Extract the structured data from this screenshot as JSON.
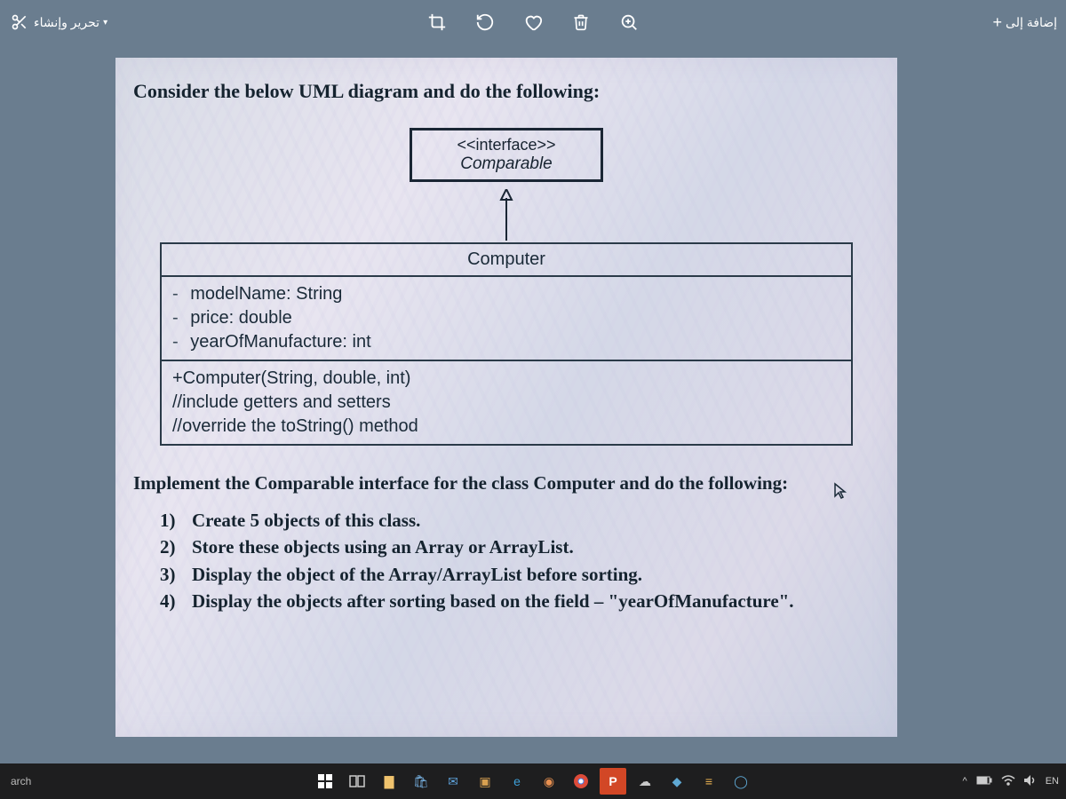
{
  "toolbar": {
    "edit_create_label": "تحرير وإنشاء",
    "add_to_label": "إضافة إلى",
    "add_prefix": "+",
    "icons": {
      "crop": "crop-icon",
      "rotate": "rotate-icon",
      "heart": "heart-icon",
      "delete": "trash-icon",
      "zoom": "magnify-icon",
      "scissors": "scissors-icon"
    }
  },
  "content": {
    "heading": "Consider the below UML diagram and do the following:",
    "interface": {
      "stereotype": "<<interface>>",
      "name": "Comparable"
    },
    "class": {
      "name": "Computer",
      "attributes": [
        {
          "vis": "-",
          "text": "modelName: String"
        },
        {
          "vis": "-",
          "text": "price: double"
        },
        {
          "vis": "-",
          "text": "yearOfManufacture: int"
        }
      ],
      "methods": [
        "+Computer(String, double, int)",
        "//include getters and setters",
        "//override the toString() method"
      ]
    },
    "instruction2": "Implement the Comparable interface for the class Computer and do the following:",
    "steps": [
      {
        "n": "1)",
        "t": "Create 5 objects of this class."
      },
      {
        "n": "2)",
        "t": "Store these objects using an Array or ArrayList."
      },
      {
        "n": "3)",
        "t": "Display the object of the Array/ArrayList before sorting."
      },
      {
        "n": "4)",
        "t": "Display the objects after sorting based on the field – \"yearOfManufacture\"."
      }
    ]
  },
  "taskbar": {
    "search_label": "arch",
    "tray_lang": "EN",
    "tray_chevron": "^"
  },
  "colors": {
    "accent": "#1a2634"
  }
}
